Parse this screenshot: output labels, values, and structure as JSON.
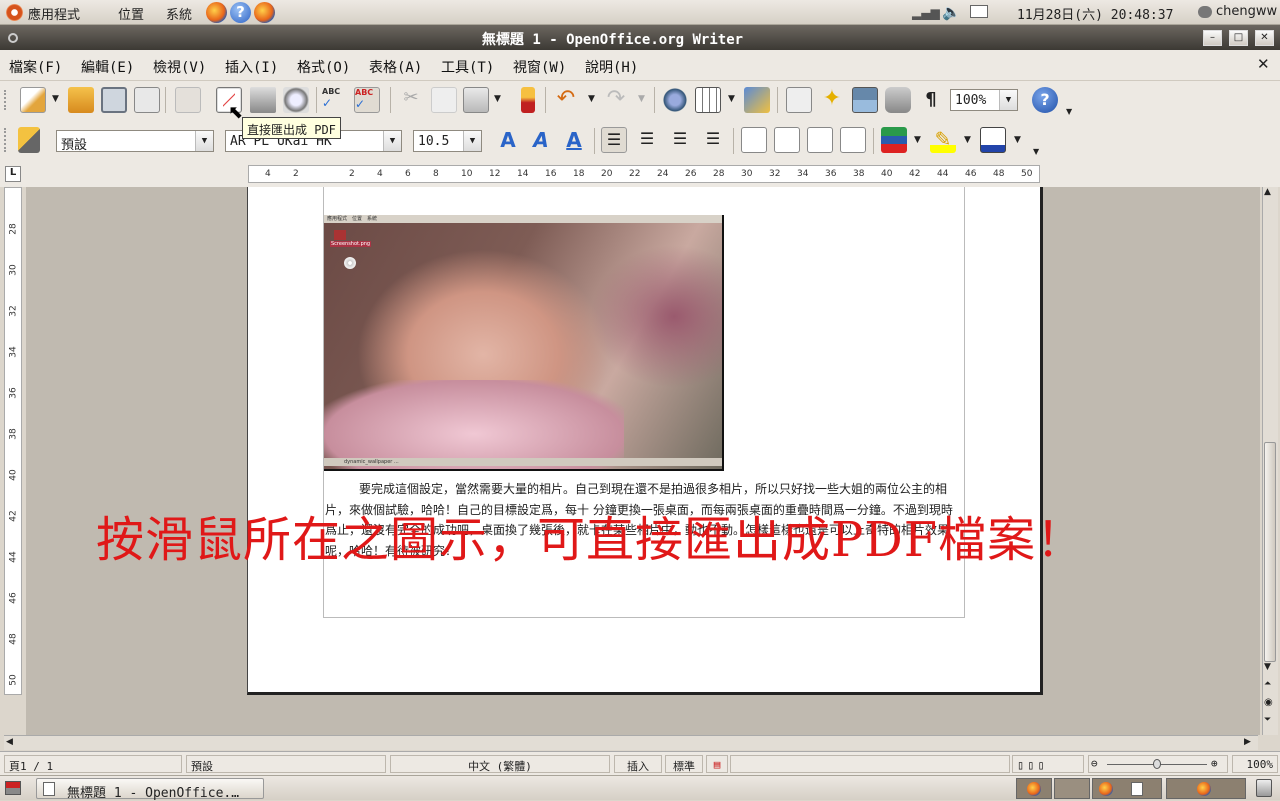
{
  "panel": {
    "menus": [
      "應用程式",
      "位置",
      "系統"
    ],
    "datetime": "11月28日(六) 20:48:37",
    "user": "chengww"
  },
  "window": {
    "title": "無標題 1 - OpenOffice.org Writer"
  },
  "menubar": [
    "檔案(F)",
    "編輯(E)",
    "檢視(V)",
    "插入(I)",
    "格式(O)",
    "表格(A)",
    "工具(T)",
    "視窗(W)",
    "說明(H)"
  ],
  "toolbar": {
    "zoom": "100%",
    "tooltip": "直接匯出成 PDF"
  },
  "format_toolbar": {
    "style": "預設",
    "font": "AR PL UKai HK",
    "size": "10.5"
  },
  "ruler": {
    "h_ticks": [
      "4",
      "2",
      "2",
      "4",
      "6",
      "8",
      "10",
      "12",
      "14",
      "16",
      "18",
      "20",
      "22",
      "24",
      "26",
      "28",
      "30",
      "32",
      "34",
      "36",
      "38",
      "40",
      "42",
      "44",
      "46",
      "48",
      "50"
    ],
    "v_ticks": [
      "28",
      "30",
      "32",
      "34",
      "36",
      "38",
      "40",
      "42",
      "44",
      "46",
      "48",
      "50"
    ]
  },
  "document": {
    "paragraph": "要完成這個設定，當然需要大量的相片。自己到現在還不是拍過很多相片，所以只好找一些大姐的兩位公主的相片，來做個試驗，哈哈！自己的目標設定爲，每十 分鐘更換一張桌面，而每兩張桌面的重疊時間爲一分鐘。不過到現時爲止，還沒有完全的成功吧，桌面換了幾張後，就卡在某些相片中，動也不動。怎樣這樣也還是可以上奇特的相片效果呢，哈哈！有待被研究！",
    "overlay": "按滑鼠所在之圖示，可直接匯出成PDF檔案！",
    "photo_panel_caption": "Screenshot.png",
    "photo_taskbar_label": "dynamic_wallpaper ..."
  },
  "statusbar": {
    "page": "頁1 / 1",
    "style": "預設",
    "language": "中文 (繁體)",
    "insert_mode": "插入",
    "selection_mode": "標準",
    "zoom": "100%"
  },
  "taskbar": {
    "task_label": "無標題 1 - OpenOffice.…"
  },
  "colors": {
    "overlay_red": "#e01818",
    "title_bar": "#4f4b45",
    "panel": "#e6e1da"
  }
}
